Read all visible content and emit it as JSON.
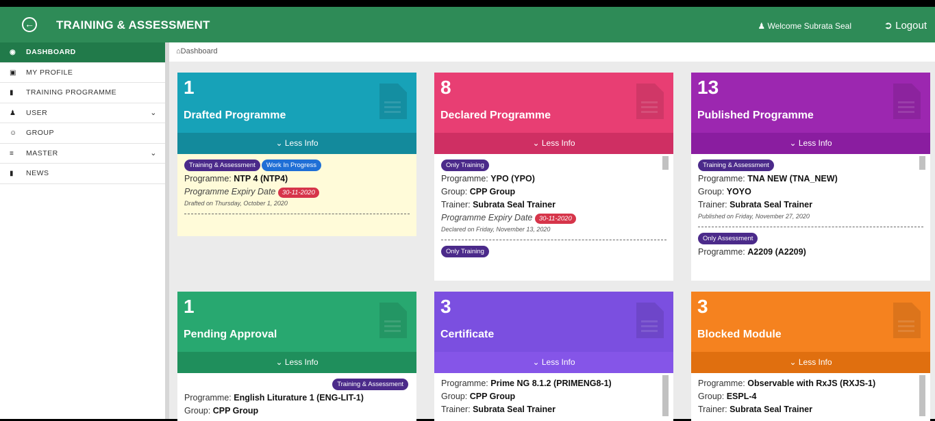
{
  "topbar": {
    "title": "TRAINING & ASSESSMENT",
    "welcome": "Welcome Subrata Seal",
    "logout": "Logout"
  },
  "sidebar": {
    "items": [
      {
        "label": "DASHBOARD",
        "icon": "dashboard-icon"
      },
      {
        "label": "MY PROFILE",
        "icon": "briefcase-icon"
      },
      {
        "label": "TRAINING PROGRAMME",
        "icon": "file-icon"
      },
      {
        "label": "USER",
        "icon": "user-icon"
      },
      {
        "label": "GROUP",
        "icon": "group-icon"
      },
      {
        "label": "MASTER",
        "icon": "list-icon"
      },
      {
        "label": "NEWS",
        "icon": "file-icon"
      }
    ]
  },
  "breadcrumb": "Dashboard",
  "less_info": "Less Info",
  "colors": {
    "drafted": "#17a2b8",
    "declared": "#e83e73",
    "published": "#9c27b0",
    "pending": "#28a870",
    "certificate": "#7b4fe0",
    "blocked": "#f5821f"
  },
  "cards": {
    "drafted": {
      "count": "1",
      "label": "Drafted Programme",
      "badges": [
        "Training & Assessment",
        "Work In Progress"
      ],
      "prog_key": "Programme:",
      "prog_val": "NTP 4 (NTP4)",
      "exp_label": "Programme Expiry Date",
      "exp_date": "30-11-2020",
      "note": "Drafted on Thursday, October 1, 2020"
    },
    "declared": {
      "count": "8",
      "label": "Declared Programme",
      "badge": "Only Training",
      "prog_key": "Programme:",
      "prog_val": "YPO (YPO)",
      "group_key": "Group:",
      "group_val": "CPP Group",
      "trainer_key": "Trainer:",
      "trainer_val": "Subrata Seal Trainer",
      "exp_label": "Programme Expiry Date",
      "exp_date": "30-11-2020",
      "note": "Declared on Friday, November 13, 2020",
      "badge2": "Only Training"
    },
    "published": {
      "count": "13",
      "label": "Published Programme",
      "badge": "Training & Assessment",
      "prog_key": "Programme:",
      "prog_val": "TNA NEW (TNA_NEW)",
      "group_key": "Group:",
      "group_val": "YOYO",
      "trainer_key": "Trainer:",
      "trainer_val": "Subrata Seal Trainer",
      "note": "Published on Friday, November 27, 2020",
      "badge2": "Only Assessment",
      "prog2_val": "A2209 (A2209)"
    },
    "pending": {
      "count": "1",
      "label": "Pending Approval",
      "badge": "Training & Assessment",
      "prog_key": "Programme:",
      "prog_val": "English Liturature 1 (ENG-LIT-1)",
      "group_key": "Group:",
      "group_val": "CPP Group"
    },
    "certificate": {
      "count": "3",
      "label": "Certificate",
      "prog_key": "Programme:",
      "prog_val": "Prime NG 8.1.2 (PRIMENG8-1)",
      "group_key": "Group:",
      "group_val": "CPP Group",
      "trainer_key": "Trainer:",
      "trainer_val": "Subrata Seal Trainer"
    },
    "blocked": {
      "count": "3",
      "label": "Blocked Module",
      "prog_key": "Programme:",
      "prog_val": "Observable with RxJS (RXJS-1)",
      "group_key": "Group:",
      "group_val": "ESPL-4",
      "trainer_key": "Trainer:",
      "trainer_val": "Subrata Seal Trainer"
    }
  }
}
